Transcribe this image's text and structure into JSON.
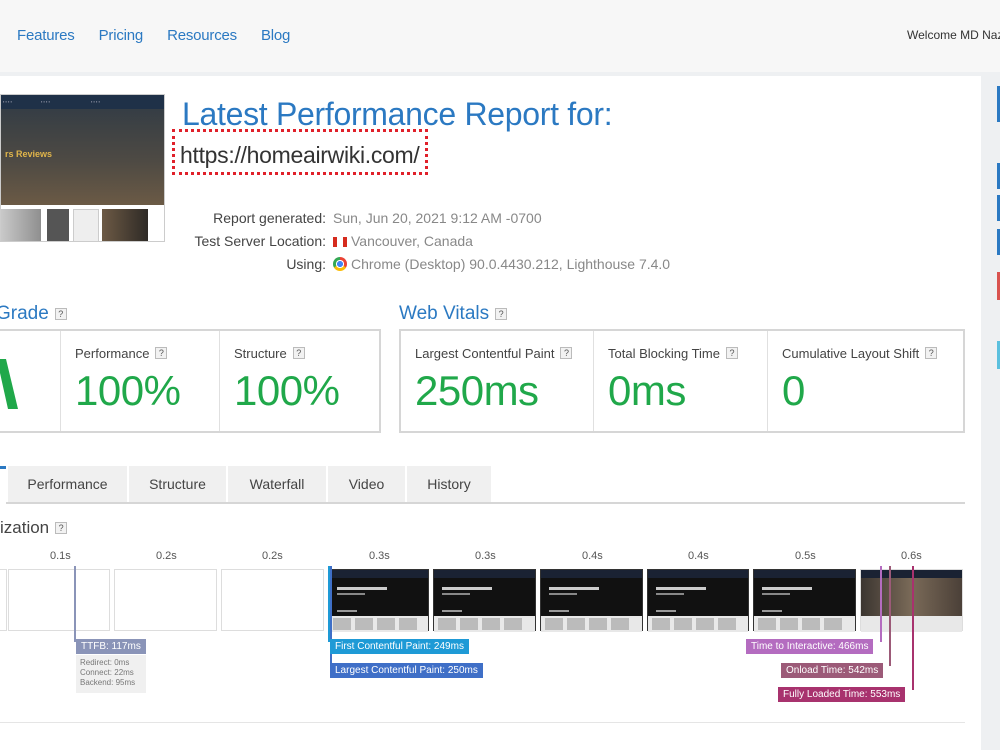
{
  "nav": {
    "items": [
      "Features",
      "Pricing",
      "Resources",
      "Blog"
    ],
    "welcome": "Welcome MD Nazr"
  },
  "report": {
    "title": "Latest Performance Report for:",
    "url": "https://homeairwiki.com/",
    "thumbnail_heading": "rs Reviews",
    "meta": {
      "generated_label": "Report generated:",
      "generated_value": "Sun, Jun 20, 2021 9:12 AM -0700",
      "location_label": "Test Server Location:",
      "location_value": "Vancouver, Canada",
      "using_label": "Using:",
      "using_value": "Chrome (Desktop) 90.0.4430.212, Lighthouse 7.4.0"
    }
  },
  "grade": {
    "heading": "Grade",
    "help": "?",
    "performance_label": "Performance",
    "performance_value": "100%",
    "structure_label": "Structure",
    "structure_value": "100%"
  },
  "web_vitals": {
    "heading": "Web Vitals",
    "help": "?",
    "lcp_label": "Largest Contentful Paint",
    "lcp_value": "250ms",
    "tbt_label": "Total Blocking Time",
    "tbt_value": "0ms",
    "cls_label": "Cumulative Layout Shift",
    "cls_value": "0"
  },
  "tabs": [
    "Performance",
    "Structure",
    "Waterfall",
    "Video",
    "History"
  ],
  "visualization": {
    "heading": "ization",
    "ticks": [
      "0.1s",
      "0.2s",
      "0.2s",
      "0.3s",
      "0.3s",
      "0.4s",
      "0.4s",
      "0.5s",
      "0.6s"
    ],
    "markers": {
      "ttfb": "TTFB: 117ms",
      "ttfb_detail": [
        "Redirect: 0ms",
        "Connect: 22ms",
        "Backend: 95ms"
      ],
      "fcp": "First Contentful Paint: 249ms",
      "lcp": "Largest Contentful Paint: 250ms",
      "tti": "Time to Interactive: 466ms",
      "onload": "Onload Time: 542ms",
      "fully_loaded": "Fully Loaded Time: 553ms"
    }
  },
  "colors": {
    "accent": "#2b79c2",
    "good": "#20a84a",
    "ttfb": "#8a94b8",
    "fcp": "#1e9ad6",
    "lcp": "#3f6fc7",
    "tti": "#b46cc0",
    "onload": "#9c5a78",
    "fully_loaded": "#a8326e"
  }
}
